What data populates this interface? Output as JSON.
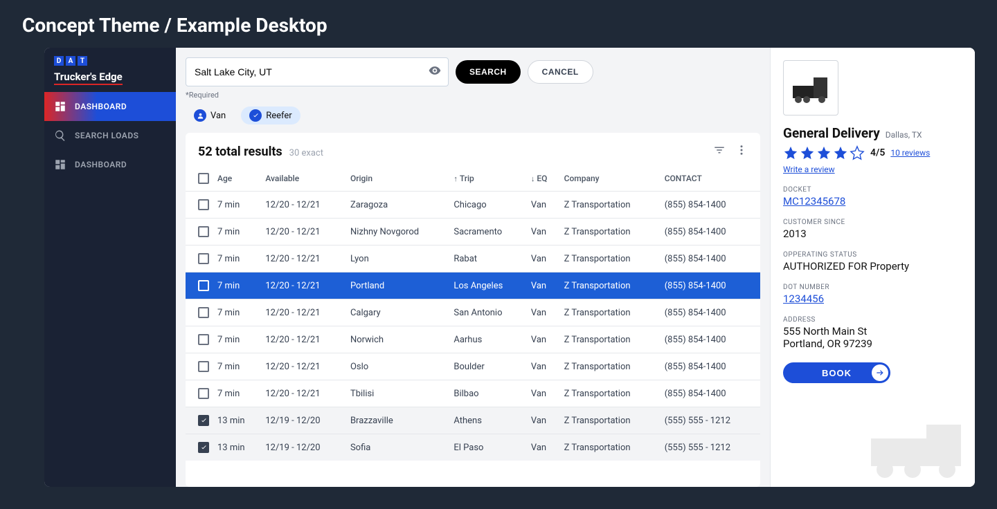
{
  "page_title": "Concept Theme / Example Desktop",
  "brand": {
    "logo_letters": [
      "D",
      "A",
      "T"
    ],
    "name": "Trucker's Edge"
  },
  "sidebar": {
    "items": [
      {
        "label": "DASHBOARD",
        "icon": "dashboard",
        "active": true
      },
      {
        "label": "SEARCH LOADS",
        "icon": "search",
        "active": false
      },
      {
        "label": "DASHBOARD",
        "icon": "dashboard",
        "active": false
      }
    ]
  },
  "search": {
    "value": "Salt Lake City, UT",
    "required_hint": "*Required",
    "search_label": "SEARCH",
    "cancel_label": "CANCEL"
  },
  "chips": [
    {
      "label": "Van",
      "icon": "user",
      "active": false
    },
    {
      "label": "Reefer",
      "icon": "check",
      "active": true
    }
  ],
  "results": {
    "count_text": "52 total results",
    "exact_text": "30 exact",
    "columns": [
      "Age",
      "Available",
      "Origin",
      "Trip",
      "EQ",
      "Company",
      "CONTACT"
    ],
    "sort_on_trip": "asc",
    "sort_on_eq": "desc",
    "rows": [
      {
        "age": "7 min",
        "available": "12/20 - 12/21",
        "origin": "Zaragoza",
        "trip": "Chicago",
        "eq": "Van",
        "company": "Z Transportation",
        "contact": "(855) 854-1400",
        "checked": false,
        "selected": false
      },
      {
        "age": "7 min",
        "available": "12/20 - 12/21",
        "origin": "Nizhny Novgorod",
        "trip": "Sacramento",
        "eq": "Van",
        "company": "Z Transportation",
        "contact": "(855) 854-1400",
        "checked": false,
        "selected": false
      },
      {
        "age": "7 min",
        "available": "12/20 - 12/21",
        "origin": "Lyon",
        "trip": "Rabat",
        "eq": "Van",
        "company": "Z Transportation",
        "contact": "(855) 854-1400",
        "checked": false,
        "selected": false
      },
      {
        "age": "7 min",
        "available": "12/20 - 12/21",
        "origin": "Portland",
        "trip": "Los Angeles",
        "eq": "Van",
        "company": "Z Transportation",
        "contact": "(855) 854-1400",
        "checked": false,
        "selected": true
      },
      {
        "age": "7 min",
        "available": "12/20 - 12/21",
        "origin": "Calgary",
        "trip": "San Antonio",
        "eq": "Van",
        "company": "Z Transportation",
        "contact": "(855) 854-1400",
        "checked": false,
        "selected": false
      },
      {
        "age": "7 min",
        "available": "12/20 - 12/21",
        "origin": "Norwich",
        "trip": "Aarhus",
        "eq": "Van",
        "company": "Z Transportation",
        "contact": "(855) 854-1400",
        "checked": false,
        "selected": false
      },
      {
        "age": "7 min",
        "available": "12/20 - 12/21",
        "origin": "Oslo",
        "trip": "Boulder",
        "eq": "Van",
        "company": "Z Transportation",
        "contact": "(855) 854-1400",
        "checked": false,
        "selected": false
      },
      {
        "age": "7 min",
        "available": "12/20 - 12/21",
        "origin": "Tbilisi",
        "trip": "Bilbao",
        "eq": "Van",
        "company": "Z Transportation",
        "contact": "(855) 854-1400",
        "checked": false,
        "selected": false
      },
      {
        "age": "13 min",
        "available": "12/19 - 12/20",
        "origin": "Brazzaville",
        "trip": "Athens",
        "eq": "Van",
        "company": "Z Transportation",
        "contact": "(555) 555 - 1212",
        "checked": true,
        "selected": false
      },
      {
        "age": "13 min",
        "available": "12/19 - 12/20",
        "origin": "Sofia",
        "trip": "El Paso",
        "eq": "Van",
        "company": "Z Transportation",
        "contact": "(555) 555 - 1212",
        "checked": true,
        "selected": false
      }
    ]
  },
  "detail": {
    "company_name": "General Delivery",
    "location": "Dallas, TX",
    "rating_value": 4,
    "rating_max": 5,
    "rating_text": "4/5",
    "reviews_link": "10 reviews",
    "write_review": "Write a review",
    "fields": [
      {
        "label": "DOCKET",
        "value": "MC12345678",
        "link": true
      },
      {
        "label": "CUSTOMER SINCE",
        "value": "2013",
        "link": false
      },
      {
        "label": "OPPERATING STATUS",
        "value": "AUTHORIZED FOR Property",
        "link": false
      },
      {
        "label": "DOT NUMBER",
        "value": "1234456",
        "link": true
      },
      {
        "label": "ADDRESS",
        "value": "555 North Main St\nPortland, OR 97239",
        "link": false
      }
    ],
    "book_label": "BOOK"
  }
}
